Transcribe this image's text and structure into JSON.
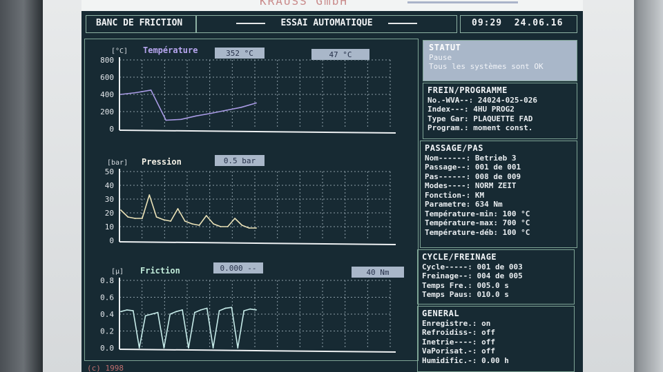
{
  "banner": {
    "text": "KRAUSS GmbH"
  },
  "header": {
    "title": "BANC DE FRICTION",
    "mode": "ESSAI AUTOMATIQUE",
    "time": "09:29",
    "date": "24.06.16"
  },
  "charts": [
    {
      "unit": "[°C]",
      "title": "Température",
      "title_color": "#b7a6f0",
      "value1": "352 °C",
      "value2": "47 °C",
      "ticks": [
        "800",
        "600",
        "400",
        "200",
        "0"
      ],
      "line_color": "#a99be6"
    },
    {
      "unit": "[bar]",
      "title": "Pression",
      "title_color": "#f4f1e6",
      "value1": "0.5 bar",
      "ticks": [
        "50",
        "40",
        "30",
        "20",
        "10",
        "0"
      ],
      "line_color": "#ece3b8"
    },
    {
      "unit": "[µ]",
      "title": "Friction",
      "title_color": "#bfead8",
      "value1": "0.000 --",
      "value2": "40  Nm",
      "ticks": [
        "0.8",
        "0.6",
        "0.4",
        "0.2",
        "0.0"
      ],
      "line_color": "#c7ecea"
    }
  ],
  "status": {
    "title": "STATUT",
    "line1": "Pause",
    "line2": "Tous les systèmes sont OK"
  },
  "frein": {
    "title": "FREIN/PROGRAMME",
    "rows": [
      {
        "k": "No.-WVA--:",
        "v": "24024-025-026"
      },
      {
        "k": "Index---:",
        "v": "4HU PROG2"
      },
      {
        "k": "Type Gar:",
        "v": "PLAQUETTE FAD"
      },
      {
        "k": "Program.:",
        "v": "moment const."
      }
    ]
  },
  "passage": {
    "title": "PASSAGE/PAS",
    "rows": [
      {
        "k": "Nom------:",
        "v": "Betrieb 3"
      },
      {
        "k": "Passage--:",
        "v": "001 de 001"
      },
      {
        "k": "Pas------:",
        "v": "008 de 009"
      },
      {
        "k": "Modes----:",
        "v": "NORM ZEIT"
      },
      {
        "k": "Fonction-:",
        "v": "KM"
      },
      {
        "k": "Parametre:",
        "v": "  634 Nm"
      },
      {
        "k": "Température-min:",
        "v": "  100 °C"
      },
      {
        "k": "Température-max:",
        "v": "  700 °C"
      },
      {
        "k": "Température-déb:",
        "v": "  100 °C"
      }
    ]
  },
  "cycle": {
    "title": "CYCLE/FREINAGE",
    "rows": [
      {
        "k": "Cycle-----:",
        "v": "001 de 003"
      },
      {
        "k": "Freinage--:",
        "v": "004 de 005"
      },
      {
        "k": "Temps Fre.:",
        "v": "005.0 s"
      },
      {
        "k": "Temps Paus:",
        "v": "010.0 s"
      }
    ]
  },
  "general": {
    "title": "GENERAL",
    "rows": [
      {
        "k": "Enregistre.:",
        "v": "on"
      },
      {
        "k": "Refroidiss-:",
        "v": "off"
      },
      {
        "k": "Inetrie----:",
        "v": "off"
      },
      {
        "k": "VaPorisat.-:",
        "v": "off"
      },
      {
        "k": "Humidific.-:",
        "v": "   0.00 h"
      }
    ]
  },
  "footer": {
    "text": "(c) 1998"
  },
  "chart_data": [
    {
      "type": "line",
      "title": "Température",
      "ylabel": "[°C]",
      "ylim": [
        0,
        800
      ],
      "y_ticks": [
        0,
        200,
        400,
        600,
        800
      ],
      "grid": true,
      "series": [
        {
          "values": [
            400,
            420,
            450,
            100,
            110,
            150,
            180,
            215,
            250,
            300
          ]
        }
      ]
    },
    {
      "type": "line",
      "title": "Pression",
      "ylabel": "[bar]",
      "ylim": [
        0,
        50
      ],
      "y_ticks": [
        0,
        10,
        20,
        30,
        40,
        50
      ],
      "grid": true,
      "series": [
        {
          "values": [
            22,
            17,
            16,
            16,
            33,
            17,
            15,
            14,
            23,
            14,
            12,
            11,
            18,
            12,
            10,
            10,
            16,
            11,
            9,
            9
          ]
        }
      ]
    },
    {
      "type": "line",
      "title": "Friction",
      "ylabel": "[µ]",
      "ylim": [
        0,
        0.8
      ],
      "y_ticks": [
        0,
        0.2,
        0.4,
        0.6,
        0.8
      ],
      "grid": true,
      "series": [
        {
          "values": [
            0.43,
            0.45,
            0.44,
            0.0,
            0.38,
            0.4,
            0.42,
            0.0,
            0.4,
            0.43,
            0.45,
            0.0,
            0.42,
            0.45,
            0.47,
            0.0,
            0.44,
            0.47,
            0.48,
            0.0,
            0.44,
            0.46,
            0.45
          ]
        }
      ]
    }
  ]
}
